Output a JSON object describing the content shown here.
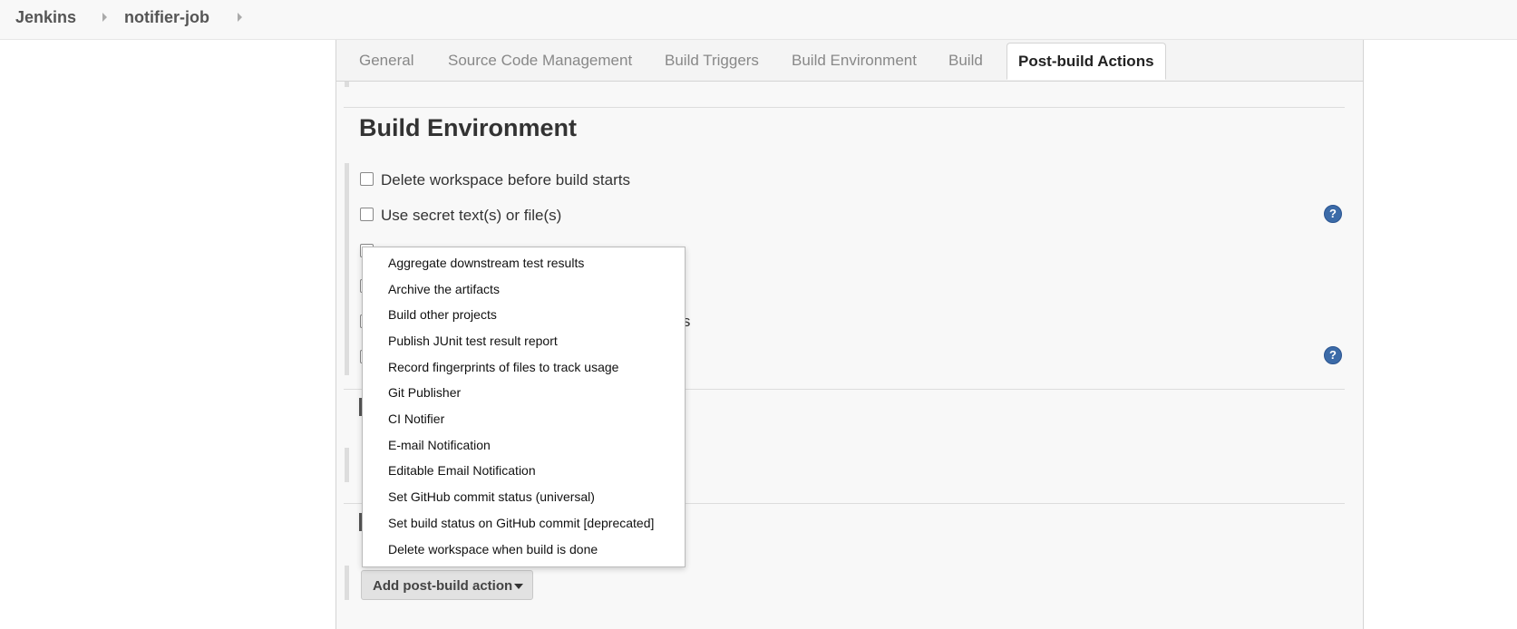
{
  "breadcrumb": {
    "items": [
      "Jenkins",
      "notifier-job"
    ]
  },
  "tabs": [
    {
      "label": "General",
      "active": false
    },
    {
      "label": "Source Code Management",
      "active": false
    },
    {
      "label": "Build Triggers",
      "active": false
    },
    {
      "label": "Build Environment",
      "active": false
    },
    {
      "label": "Build",
      "active": false
    },
    {
      "label": "Post-build Actions",
      "active": true
    }
  ],
  "build_environment": {
    "title": "Build Environment",
    "options": [
      {
        "label": "Delete workspace before build starts",
        "checked": false
      },
      {
        "label": "Use secret text(s) or file(s)",
        "checked": false
      }
    ],
    "partial_text": "ans",
    "help_label": "?"
  },
  "post_build": {
    "add_button_label": "Add post-build action",
    "menu_items": [
      "Aggregate downstream test results",
      "Archive the artifacts",
      "Build other projects",
      "Publish JUnit test result report",
      "Record fingerprints of files to track usage",
      "Git Publisher",
      "CI Notifier",
      "E-mail Notification",
      "Editable Email Notification",
      "Set GitHub commit status (universal)",
      "Set build status on GitHub commit [deprecated]",
      "Delete workspace when build is done"
    ]
  },
  "colors": {
    "help_icon": "#3c6ba8",
    "panel_bg": "#f8f8f8"
  }
}
